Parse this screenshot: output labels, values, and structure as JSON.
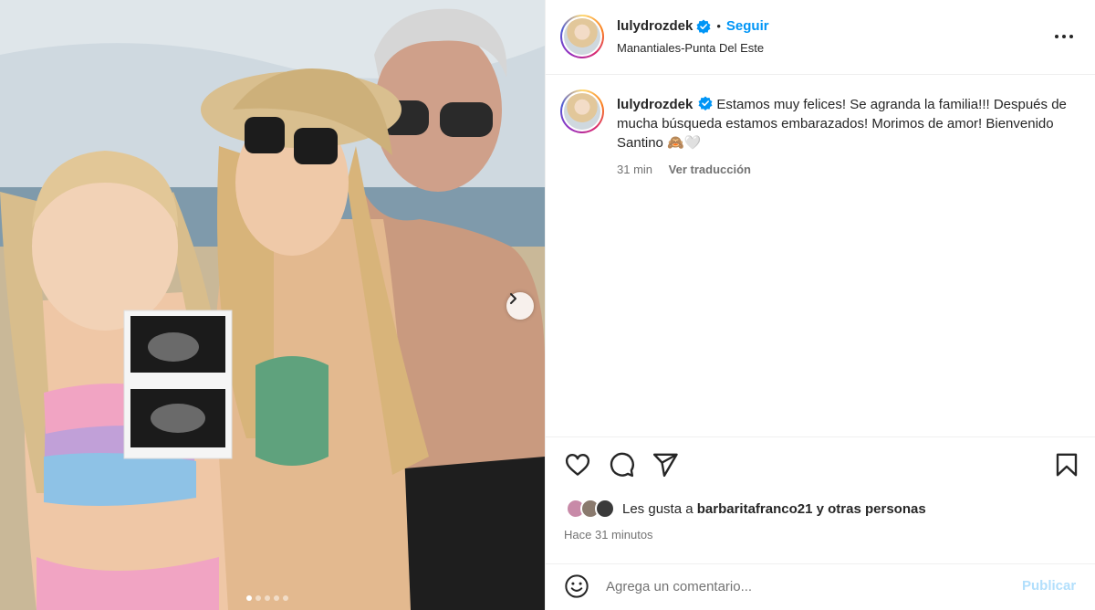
{
  "post": {
    "username": "lulydrozdek",
    "follow_label": "Seguir",
    "separator": "•",
    "location": "Manantiales-Punta Del Este",
    "more_icon": "more-horizontal-icon"
  },
  "caption": {
    "username": "lulydrozdek",
    "text": "Estamos muy felices! Se agranda la familia!!! Después de mucha búsqueda estamos embarazados! Morimos de amor! Bienvenido Santino 🙈🤍",
    "time": "31 min",
    "translate_label": "Ver traducción"
  },
  "actions": {
    "like_icon": "heart-icon",
    "comment_icon": "comment-icon",
    "share_icon": "send-icon",
    "save_icon": "bookmark-icon"
  },
  "likes": {
    "prefix": "Les gusta a",
    "user": "barbaritafranco21",
    "suffix": "y otras personas"
  },
  "timestamp": "Hace 31 minutos",
  "comment": {
    "placeholder": "Agrega un comentario...",
    "publish_label": "Publicar"
  },
  "carousel": {
    "total_slides": 5,
    "active_slide": 1
  },
  "colors": {
    "accent": "#0095f6",
    "publish_disabled": "#b2dffc",
    "secondary_text": "#737373"
  }
}
